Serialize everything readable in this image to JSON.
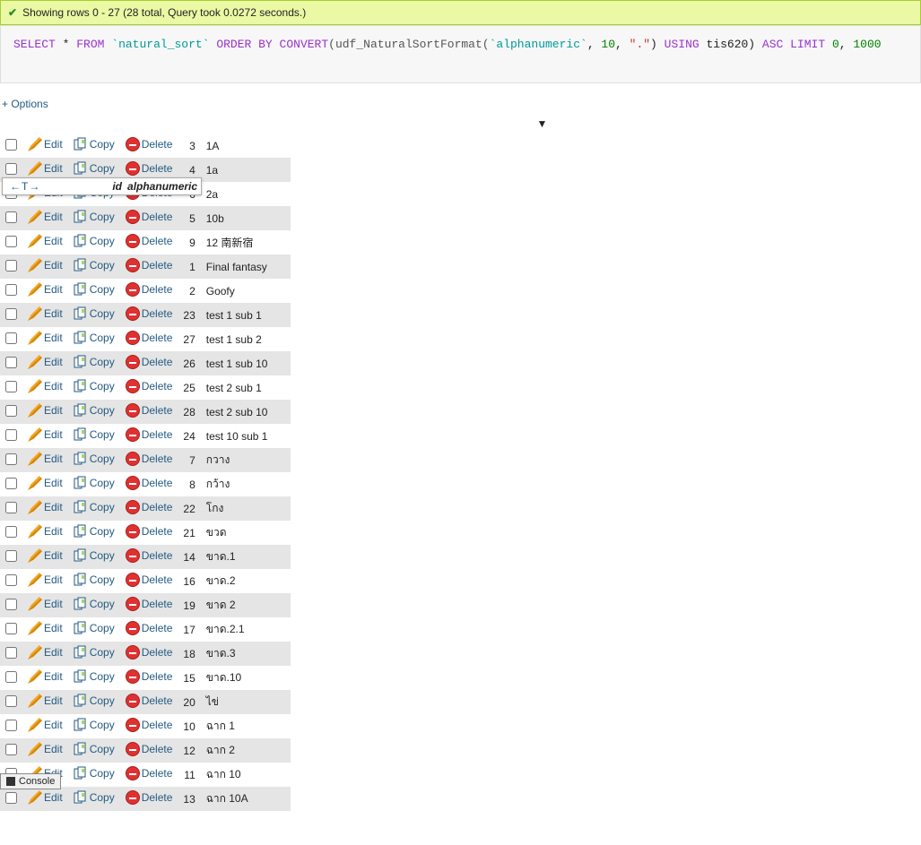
{
  "banner": {
    "check": "✔",
    "message": "Showing rows 0 - 27 (28 total, Query took 0.0272 seconds.)"
  },
  "sql": {
    "select": "SELECT",
    "star": "*",
    "from": "FROM",
    "table": "`natural_sort`",
    "orderby": "ORDER BY",
    "convert": "CONVERT",
    "func": "(udf_NaturalSortFormat(",
    "col": "`alphanumeric`",
    "comma1": ", ",
    "ten": "10",
    "comma2": ", ",
    "dot": "\".\"",
    "close": ")",
    "using": "USING",
    "charset": " tis620) ",
    "asc": "ASC",
    "limit": "LIMIT",
    "zero": "0",
    "comma3": ", ",
    "thousand": "1000"
  },
  "options_label": "+ Options",
  "sort_arrow": "▼",
  "labels": {
    "edit": "Edit",
    "copy": "Copy",
    "delete": "Delete"
  },
  "header": {
    "nav": "←T→",
    "id": "id",
    "alpha": "alphanumeric"
  },
  "console": "Console",
  "rows": [
    {
      "id": "3",
      "val": "1A"
    },
    {
      "id": "4",
      "val": "1a"
    },
    {
      "id": "6",
      "val": "2a"
    },
    {
      "id": "5",
      "val": "10b"
    },
    {
      "id": "9",
      "val": "12 南新宿"
    },
    {
      "id": "1",
      "val": "Final fantasy"
    },
    {
      "id": "2",
      "val": "Goofy"
    },
    {
      "id": "23",
      "val": "test 1 sub 1"
    },
    {
      "id": "27",
      "val": "test 1 sub 2"
    },
    {
      "id": "26",
      "val": "test 1 sub 10"
    },
    {
      "id": "25",
      "val": "test 2 sub 1"
    },
    {
      "id": "28",
      "val": "test 2 sub 10"
    },
    {
      "id": "24",
      "val": "test 10 sub 1"
    },
    {
      "id": "7",
      "val": "กวาง"
    },
    {
      "id": "8",
      "val": "กว้าง"
    },
    {
      "id": "22",
      "val": "โกง"
    },
    {
      "id": "21",
      "val": "ขวด"
    },
    {
      "id": "14",
      "val": "ขาด.1"
    },
    {
      "id": "16",
      "val": "ขาด.2"
    },
    {
      "id": "19",
      "val": "ขาด 2"
    },
    {
      "id": "17",
      "val": "ขาด.2.1"
    },
    {
      "id": "18",
      "val": "ขาด.3"
    },
    {
      "id": "15",
      "val": "ขาด.10"
    },
    {
      "id": "20",
      "val": "ไข่"
    },
    {
      "id": "10",
      "val": "ฉาก 1"
    },
    {
      "id": "12",
      "val": "ฉาก 2"
    },
    {
      "id": "11",
      "val": "ฉาก 10"
    },
    {
      "id": "13",
      "val": "ฉาก 10A"
    }
  ]
}
